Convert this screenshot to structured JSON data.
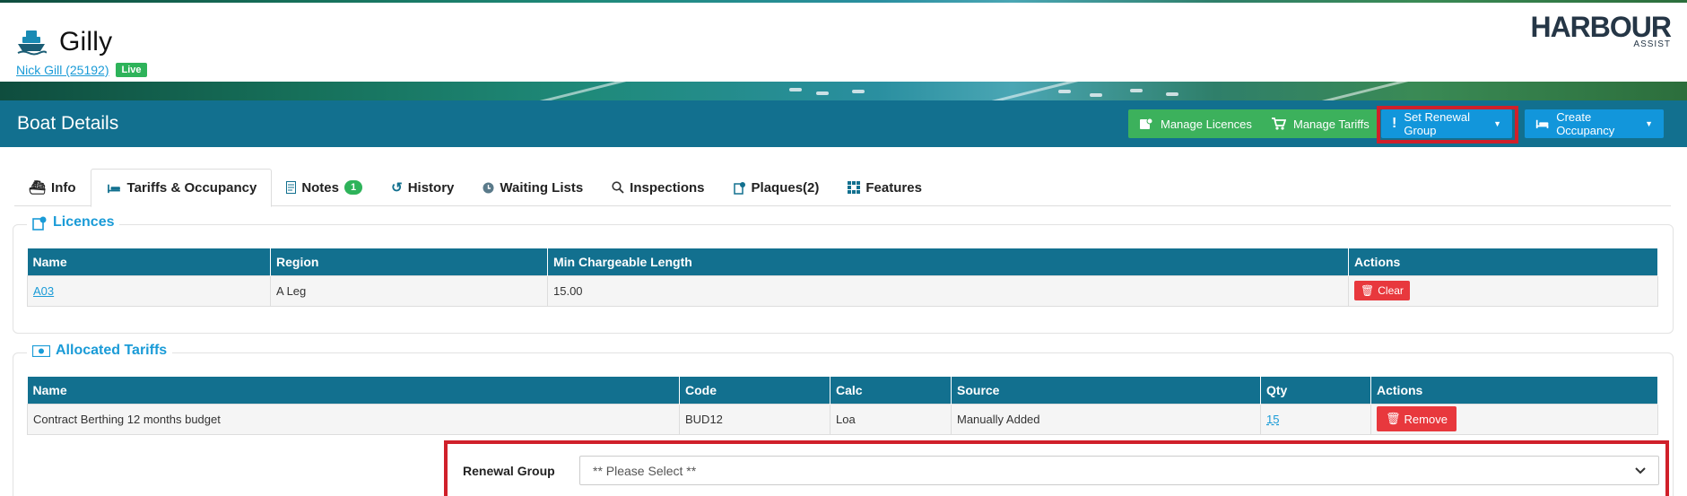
{
  "header": {
    "boat_name": "Gilly",
    "owner_link": "Nick Gill (25192)",
    "status_badge": "Live",
    "logo_main": "HARBOUR",
    "logo_sub": "ASSIST"
  },
  "panel": {
    "title": "Boat Details",
    "buttons": {
      "manage_licences": "Manage Licences",
      "manage_tariffs": "Manage Tariffs",
      "set_renewal_group": "Set Renewal Group",
      "create_occupancy": "Create Occupancy"
    }
  },
  "tabs": [
    {
      "label": "Info",
      "icon": "ship-icon"
    },
    {
      "label": "Tariffs & Occupancy",
      "icon": "bed-icon"
    },
    {
      "label": "Notes",
      "icon": "document-icon",
      "badge": "1"
    },
    {
      "label": "History",
      "icon": "history-icon"
    },
    {
      "label": "Waiting Lists",
      "icon": "clock-icon"
    },
    {
      "label": "Inspections",
      "icon": "search-icon"
    },
    {
      "label": "Plaques(2)",
      "icon": "plaque-icon"
    },
    {
      "label": "Features",
      "icon": "grid-icon"
    }
  ],
  "licences": {
    "title": "Licences",
    "columns": [
      "Name",
      "Region",
      "Min Chargeable Length",
      "Actions"
    ],
    "rows": [
      {
        "name": "A03",
        "region": "A Leg",
        "min_length": "15.00",
        "action": "Clear"
      }
    ]
  },
  "tariffs": {
    "title": "Allocated Tariffs",
    "columns": [
      "Name",
      "Code",
      "Calc",
      "Source",
      "Qty",
      "Actions"
    ],
    "rows": [
      {
        "name": "Contract Berthing 12 months budget",
        "code": "BUD12",
        "calc": "Loa",
        "source": "Manually Added",
        "qty": "15",
        "action": "Remove"
      }
    ]
  },
  "renewal_group": {
    "label": "Renewal Group",
    "selected": "** Please Select **"
  },
  "colors": {
    "header_teal": "#12708f",
    "green": "#3cb15c",
    "blue": "#1296db",
    "red": "#e8383d",
    "highlight": "#d0202a",
    "link": "#1a9bd7"
  }
}
